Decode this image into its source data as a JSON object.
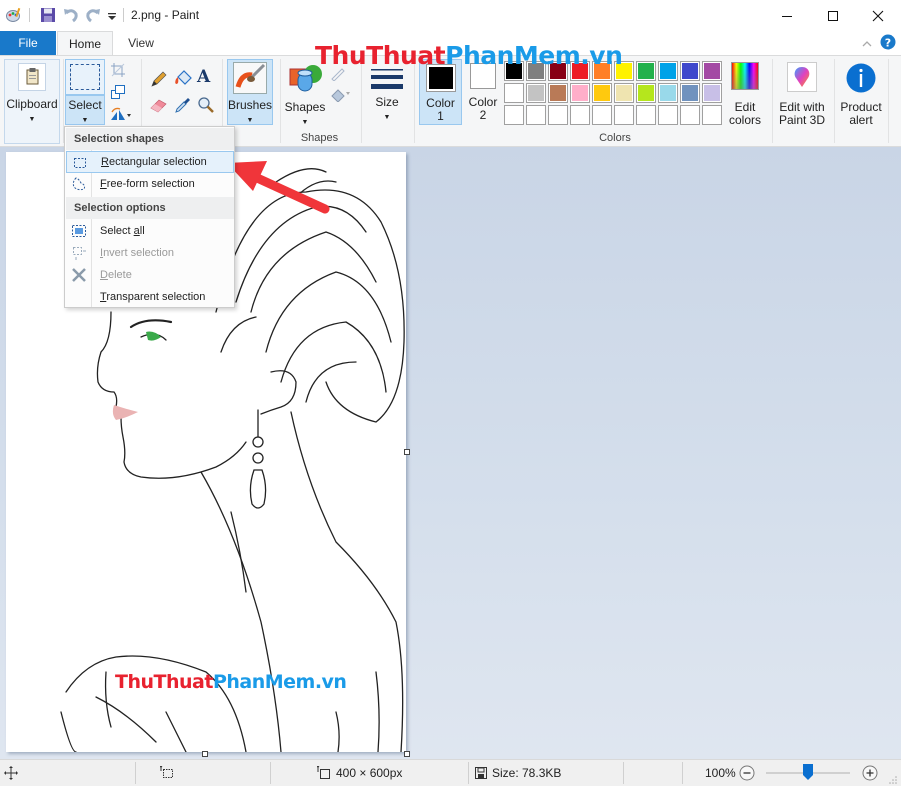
{
  "window": {
    "title": "2.png - Paint",
    "controls": {
      "minimize": "minimize-icon",
      "maximize": "maximize-icon",
      "close": "close-icon"
    }
  },
  "quick_access": {
    "icons": [
      "paint-app-icon",
      "save-icon",
      "undo-icon",
      "redo-icon",
      "customize-dropdown-icon"
    ]
  },
  "tabs": [
    {
      "label": "File",
      "active": false,
      "style": "file"
    },
    {
      "label": "Home",
      "active": true
    },
    {
      "label": "View",
      "active": false
    }
  ],
  "ribbon": {
    "clipboard": {
      "label": "Clipboard"
    },
    "image": {
      "select_label": "Select",
      "tools": [
        "crop-icon",
        "resize-icon",
        "rotate-icon"
      ]
    },
    "tools": [
      "pencil-icon",
      "fill-icon",
      "text-icon",
      "eraser-icon",
      "color-picker-icon",
      "magnifier-icon"
    ],
    "brushes": {
      "label": "Brushes"
    },
    "shapes": {
      "label": "Shapes",
      "group_label": "Shapes",
      "sub_tools": [
        "outline-icon",
        "fill-shape-icon"
      ]
    },
    "size": {
      "label": "Size"
    },
    "color1": {
      "label": "Color",
      "num": "1",
      "color": "#000000"
    },
    "color2": {
      "label": "Color",
      "num": "2",
      "color": "#ffffff"
    },
    "colors_group_label": "Colors",
    "palette_row1": [
      "#000000",
      "#7f7f7f",
      "#880015",
      "#ed1c24",
      "#ff7f27",
      "#fff200",
      "#22b14c",
      "#00a2e8",
      "#3f48cc",
      "#a349a4"
    ],
    "palette_row2": [
      "#ffffff",
      "#c3c3c3",
      "#b97a57",
      "#ffaec9",
      "#ffc90e",
      "#efe4b0",
      "#b5e61d",
      "#99d9ea",
      "#7092be",
      "#c8bfe7"
    ],
    "palette_row3_count": 10,
    "edit_colors": {
      "line1": "Edit",
      "line2": "colors"
    },
    "paint3d": {
      "line1": "Edit with",
      "line2": "Paint 3D"
    },
    "product_alert": {
      "line1": "Product",
      "line2": "alert"
    },
    "collapse_icon": "chevron-up-icon",
    "help_icon": "help-icon"
  },
  "select_menu": {
    "header1": "Selection shapes",
    "shapes": [
      {
        "pre": "",
        "ul": "R",
        "post": "ectangular selection",
        "disabled": false,
        "hover": true,
        "icon": "rectangle-selection-icon"
      },
      {
        "pre": "",
        "ul": "F",
        "post": "ree-form selection",
        "disabled": false,
        "hover": false,
        "icon": "freeform-selection-icon"
      }
    ],
    "header2": "Selection options",
    "options": [
      {
        "pre": "Select ",
        "ul": "a",
        "post": "ll",
        "disabled": false,
        "icon": "select-all-icon"
      },
      {
        "pre": "",
        "ul": "I",
        "post": "nvert selection",
        "disabled": true,
        "icon": "invert-selection-icon"
      },
      {
        "pre": "",
        "ul": "D",
        "post": "elete",
        "disabled": true,
        "icon": "delete-icon"
      },
      {
        "pre": "",
        "ul": "T",
        "post": "ransparent selection",
        "disabled": false,
        "icon": "transparent-selection-icon"
      }
    ]
  },
  "watermarks": {
    "top": {
      "red": "ThuThuat",
      "blue": "PhanMem.vn"
    },
    "canvas": {
      "red": "ThuThuat",
      "blue": "PhanMem.vn"
    }
  },
  "status": {
    "cursor_pos": "",
    "selection_size": "",
    "image_size": "400 × 600px",
    "file_size": "Size: 78.3KB",
    "zoom": "100%",
    "zoom_slider_value": 0.5
  }
}
